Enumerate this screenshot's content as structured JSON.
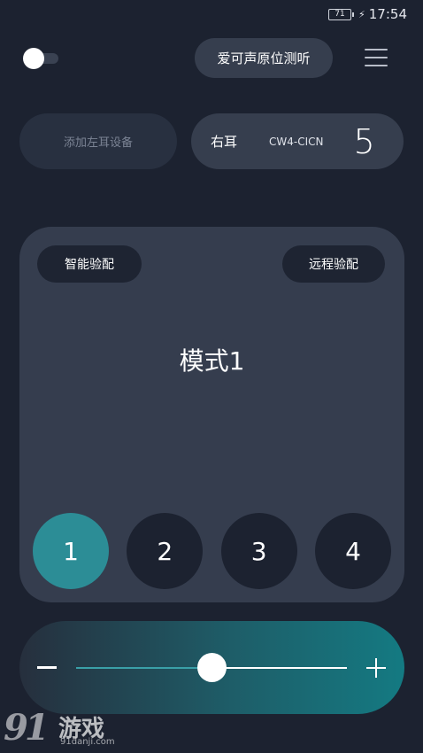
{
  "status_bar": {
    "battery": "71",
    "time": "17:54"
  },
  "header": {
    "toggle_on": false,
    "listen_button": "爱可声原位测听",
    "menu_icon": "menu-icon"
  },
  "devices": {
    "left_add": "添加左耳设备",
    "right": {
      "side": "右耳",
      "model": "CW4-CICN",
      "number": "5"
    }
  },
  "mode_panel": {
    "smart_fit": "智能验配",
    "remote_fit": "远程验配",
    "title": "模式1",
    "modes": [
      "1",
      "2",
      "3",
      "4"
    ],
    "active_mode": "1"
  },
  "volume": {
    "level_percent": 50,
    "minus_icon": "minus-icon",
    "plus_icon": "plus-icon"
  },
  "watermark": {
    "logo": "91",
    "brand": "游戏",
    "site": "91danji.com"
  },
  "colors": {
    "background": "#1c2230",
    "panel": "#353d4e",
    "active_mode": "#2c8d96",
    "volume_gradient_end": "#147a82"
  }
}
